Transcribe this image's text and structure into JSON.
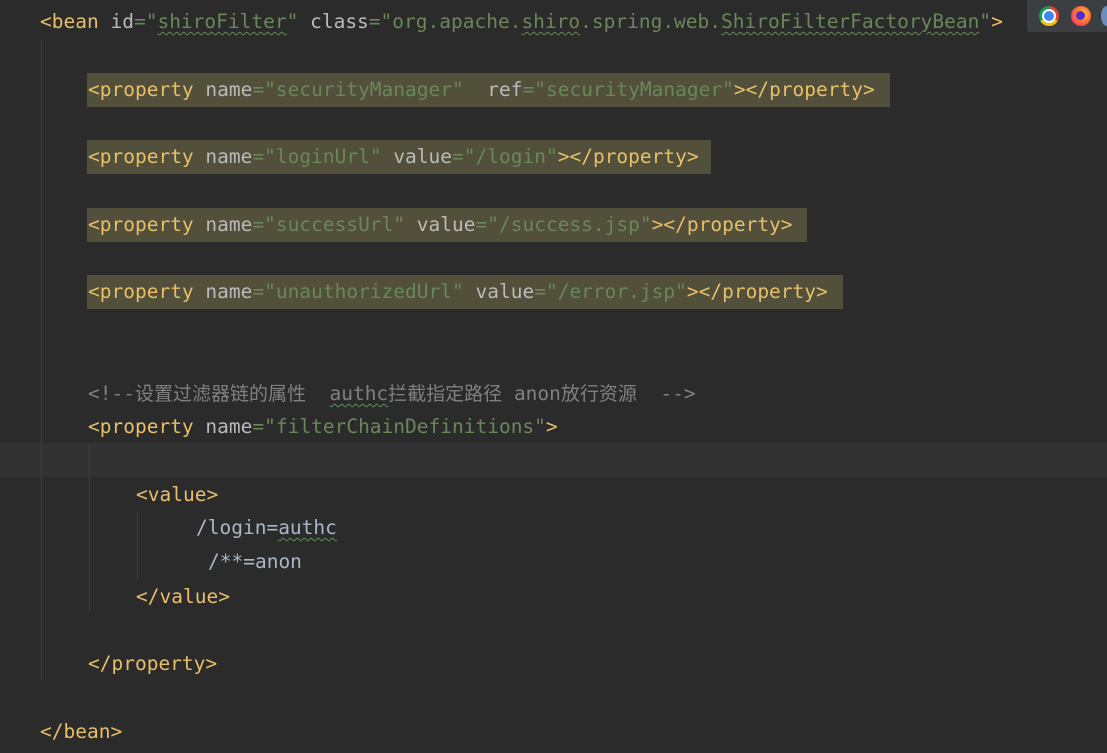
{
  "tokens": {
    "lt": "<",
    "ltslash": "</",
    "gt": ">",
    "endgt": "></",
    "eq": "=",
    "q": "\"",
    "sp": " ",
    "sp2": "  ",
    "arrow": "-->",
    "comment_open": "<!--"
  },
  "line1": {
    "tag": "bean",
    "attr_id": "id",
    "val_id": "shiroFilter",
    "attr_class": "class",
    "val_class_pre": "org.apache.",
    "val_class_shiro": "shiro",
    "val_class_mid": ".spring.web.",
    "val_class_factory": "ShiroFilterFactoryBean"
  },
  "line2": {
    "tag": "property",
    "attr_name": "name",
    "val_name": "securityManager",
    "attr_ref": "ref",
    "val_ref": "securityManager"
  },
  "line3": {
    "tag": "property",
    "attr_name": "name",
    "val_name": "loginUrl",
    "attr_value": "value",
    "val_value": "/login"
  },
  "line4": {
    "tag": "property",
    "attr_name": "name",
    "val_name": "successUrl",
    "attr_value": "value",
    "val_value": "/success.jsp"
  },
  "line5": {
    "tag": "property",
    "attr_name": "name",
    "val_name": "unauthorizedUrl",
    "attr_value": "value",
    "val_value": "/error.jsp"
  },
  "comment": {
    "part1": "设置过滤器链的属性",
    "authc": "authc",
    "part2": "拦截指定路径",
    "anon": "anon",
    "part3": "放行资源"
  },
  "line6": {
    "tag": "property",
    "attr_name": "name",
    "val_name": "filterChainDefinitions"
  },
  "value_block": {
    "open_tag": "value",
    "login_path": "/login=",
    "login_filter": "authc",
    "anon_rule": "/**=anon",
    "close_tag": "value"
  },
  "closing": {
    "property": "property",
    "bean": "bean"
  },
  "browsers": {
    "chrome": "chrome-icon",
    "firefox": "firefox-icon"
  },
  "colors": {
    "background": "#2b2b2b",
    "tag": "#e8bf6a",
    "attribute": "#bababa",
    "string": "#6a8759",
    "comment": "#808080",
    "text": "#a9b7c6",
    "highlight": "#52503a"
  }
}
